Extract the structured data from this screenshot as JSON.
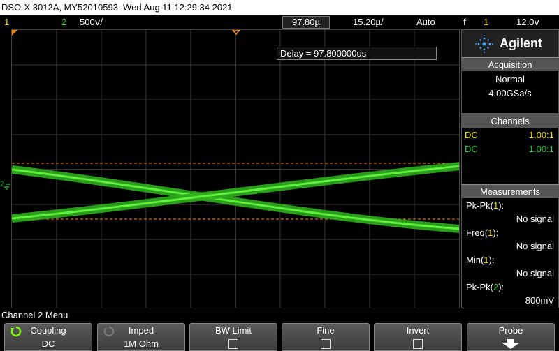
{
  "title": "DSO-X 3012A, MY52010593: Wed Aug 11 12:29:34 2021",
  "status": {
    "ch1_label": "1",
    "ch2_label": "2",
    "ch2_scale": "500ⅴ/",
    "delay_value": "97.80µ",
    "time_scale": "15.20µ/",
    "trigger_mode": "Auto",
    "trigger_symbol": "f",
    "trigger_channel": "1",
    "trigger_level": "12.0ⅴ"
  },
  "screen": {
    "delay_text": "Delay = 97.800000us",
    "ch2_marker": "2"
  },
  "side": {
    "brand": "Agilent",
    "acquisition": {
      "header": "Acquisition",
      "mode": "Normal",
      "rate": "4.00GSa/s"
    },
    "channels": {
      "header": "Channels",
      "rows": [
        {
          "coupling": "DC",
          "probe": "1.00:1",
          "color": "#f0e000"
        },
        {
          "coupling": "DC",
          "probe": "1.00:1",
          "color": "#2ecc40"
        }
      ]
    },
    "measurements": {
      "header": "Measurements",
      "items": [
        {
          "name": "Pk-Pk",
          "ch": "1",
          "value": "No signal"
        },
        {
          "name": "Freq",
          "ch": "1",
          "value": "No signal"
        },
        {
          "name": "Min",
          "ch": "1",
          "value": "No signal"
        },
        {
          "name": "Pk-Pk",
          "ch": "2",
          "value": "800mV"
        }
      ]
    }
  },
  "menu": {
    "title": "Channel 2 Menu",
    "softkeys": [
      {
        "label": "Coupling",
        "value": "DC"
      },
      {
        "label": "Imped",
        "value": "1M Ohm"
      },
      {
        "label": "BW Limit",
        "value": ""
      },
      {
        "label": "Fine",
        "value": ""
      },
      {
        "label": "Invert",
        "value": ""
      },
      {
        "label": "Probe",
        "value": ""
      }
    ]
  },
  "colors": {
    "ch1": "#f0e000",
    "ch2": "#2ecc40",
    "trace": "#33cc22",
    "cursor": "#ff8c00"
  }
}
